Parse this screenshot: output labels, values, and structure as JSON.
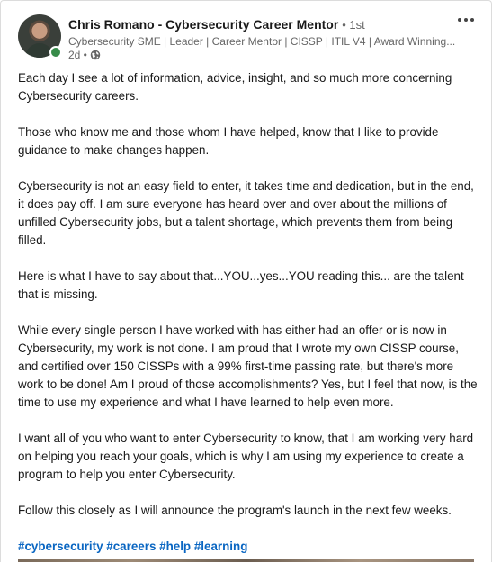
{
  "author": {
    "name": "Chris Romano - Cybersecurity Career Mentor",
    "degree": "• 1st",
    "headline": "Cybersecurity SME | Leader | Career Mentor | CISSP | ITIL V4 | Award Winning...",
    "timestamp": "2d •",
    "visibility_icon": "globe-icon",
    "online_color": "#378b49"
  },
  "post": {
    "paragraphs": [
      "Each day I see a lot of information, advice, insight, and so much more concerning Cybersecurity careers.",
      "Those who know me and those whom I have helped, know that I like to provide guidance to make changes happen.",
      "Cybersecurity is not an easy field to enter, it takes time and dedication, but in the end, it does pay off. I am sure everyone has heard over and over about the millions of unfilled Cybersecurity jobs, but a talent shortage, which prevents them from being filled.",
      "Here is what I have to say about that...YOU...yes...YOU reading this... are the talent that is missing.",
      "While every single person I have worked with has either had an offer or is now in Cybersecurity, my work is not done. I am proud that I wrote my own CISSP course, and certified over 150 CISSPs with a 99% first-time passing rate, but there's more work to be done! Am I proud of those accomplishments? Yes, but I feel that now, is the time to use my experience and what I have learned to help even more.",
      "I want all of you who want to enter Cybersecurity to know, that I am working very hard on helping you reach your goals, which is why I am using my experience to create a program to help you enter Cybersecurity.",
      "Follow this closely as I will announce the program's launch in the next few weeks."
    ],
    "hashtags": [
      "#cybersecurity",
      "#careers",
      "#help",
      "#learning"
    ],
    "hashtag_color": "#0a66c2"
  },
  "controls": {
    "more_icon": "more-horizontal-icon"
  }
}
